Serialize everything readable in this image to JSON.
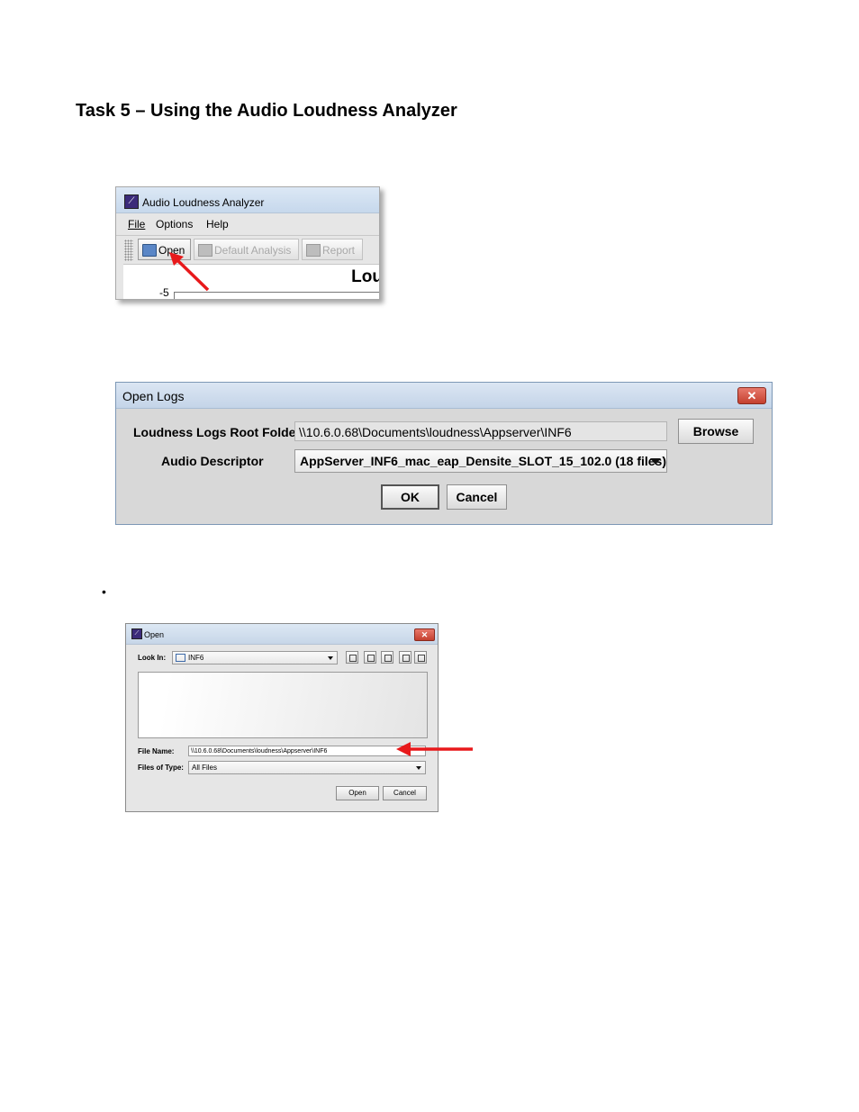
{
  "heading": "Task 5 – Using the Audio Loudness Analyzer",
  "analyzer_window": {
    "title": "Audio Loudness Analyzer",
    "menu": [
      {
        "label": "File"
      },
      {
        "label": "Options"
      },
      {
        "label": "Help"
      }
    ],
    "toolbar": {
      "open_label": "Open",
      "default_analysis_label": "Default Analysis",
      "report_label": "Report"
    },
    "chart_title_fragment": "Lou",
    "axis_tick": "-5"
  },
  "open_logs_dialog": {
    "title": "Open Logs",
    "close_glyph": "✕",
    "root_folder_label": "Loudness Logs Root Folder",
    "root_folder_value": "\\\\10.6.0.68\\Documents\\loudness\\Appserver\\INF6",
    "browse_label": "Browse",
    "audio_descriptor_label": "Audio Descriptor",
    "audio_descriptor_value": "AppServer_INF6_mac_eap_Densite_SLOT_15_102.0 (18 files)",
    "ok_label": "OK",
    "cancel_label": "Cancel"
  },
  "bullet": "•",
  "file_chooser": {
    "title": "Open",
    "close_glyph": "✕",
    "look_in_label": "Look In:",
    "look_in_value": "INF6",
    "file_name_label": "File Name:",
    "file_name_value": "\\\\10.6.0.68\\Documents\\loudness\\Appserver\\INF6",
    "files_of_type_label": "Files of Type:",
    "files_of_type_value": "All Files",
    "open_label": "Open",
    "cancel_label": "Cancel"
  },
  "colors": {
    "annotation_arrow": "#e8191b",
    "title_bar": "#c6d8ec",
    "close_button": "#c4402f"
  }
}
